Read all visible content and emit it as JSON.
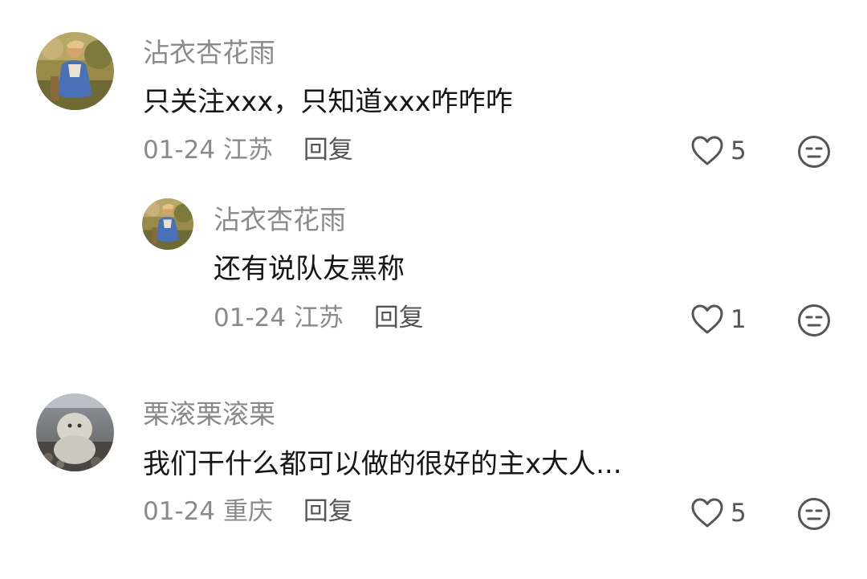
{
  "comments": [
    {
      "username": "沾衣杏花雨",
      "content": "只关注xxx，只知道xxx咋咋咋",
      "date": "01-24",
      "location": "江苏",
      "reply_label": "回复",
      "like_count": "5",
      "avatar_icon": "painting-avatar-icon"
    },
    {
      "username": "沾衣杏花雨",
      "content": "还有说队友黑称",
      "date": "01-24",
      "location": "江苏",
      "reply_label": "回复",
      "like_count": "1",
      "avatar_icon": "painting-avatar-icon"
    },
    {
      "username": "栗滚栗滚栗",
      "content": "我们干什么都可以做的很好的主x大人...",
      "date": "01-24",
      "location": "重庆",
      "reply_label": "回复",
      "like_count": "5",
      "avatar_icon": "snowman-avatar-icon"
    }
  ],
  "colors": {
    "username": "#8a8a8a",
    "text": "#161616",
    "meta": "#8a8a8a",
    "icon": "#555555"
  }
}
